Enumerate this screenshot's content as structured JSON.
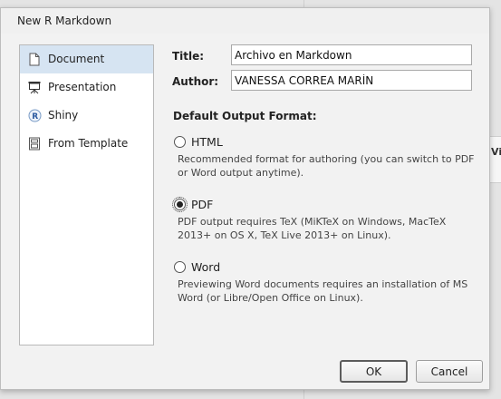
{
  "dialog": {
    "title": "New R Markdown"
  },
  "sidebar": {
    "items": [
      {
        "label": "Document",
        "icon": "document-icon",
        "selected": true
      },
      {
        "label": "Presentation",
        "icon": "presentation-icon",
        "selected": false
      },
      {
        "label": "Shiny",
        "icon": "shiny-r-icon",
        "selected": false
      },
      {
        "label": "From Template",
        "icon": "template-icon",
        "selected": false
      }
    ]
  },
  "form": {
    "title_label": "Title:",
    "title_value": "Archivo en Markdown",
    "author_label": "Author:",
    "author_value": "VANESSA CORREA MARÍN",
    "output_format_heading": "Default Output Format:",
    "formats": [
      {
        "label": "HTML",
        "checked": false,
        "description_line1": "Recommended format for authoring (you can switch to PDF",
        "description_line2": "or Word output anytime)."
      },
      {
        "label": "PDF",
        "checked": true,
        "description_line1": "PDF output requires TeX (MiKTeX on Windows, MacTeX",
        "description_line2": "2013+ on OS X, TeX Live 2013+ on Linux)."
      },
      {
        "label": "Word",
        "checked": false,
        "description_line1": "Previewing Word documents requires an installation of MS",
        "description_line2": "Word (or Libre/Open Office on Linux)."
      }
    ]
  },
  "buttons": {
    "ok_label": "OK",
    "cancel_label": "Cancel"
  },
  "background": {
    "partial_text": "Vi"
  }
}
